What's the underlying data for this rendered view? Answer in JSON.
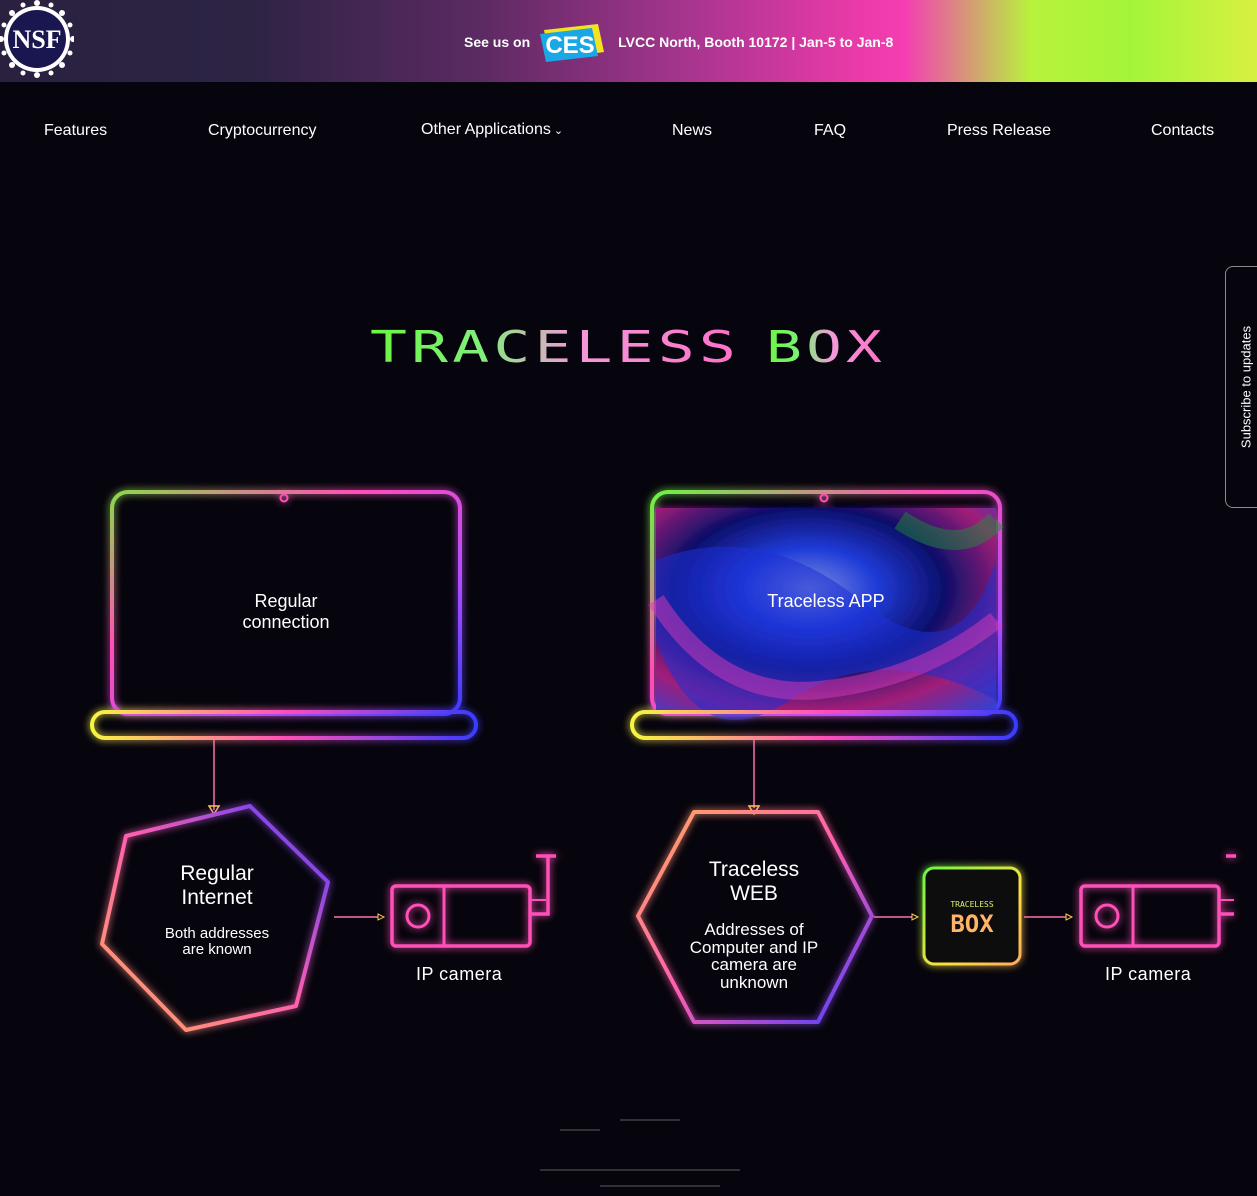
{
  "banner": {
    "nsf_label": "NSF",
    "ces_prefix": "See us on",
    "ces_logo_text": "CES",
    "ces_details": "LVCC North, Booth 10172 | Jan-5 to Jan-8"
  },
  "nav": {
    "items": [
      {
        "label": "Features"
      },
      {
        "label": "Cryptocurrency"
      },
      {
        "label": "Other Applications"
      },
      {
        "label": "News"
      },
      {
        "label": "FAQ"
      },
      {
        "label": "Press Release"
      },
      {
        "label": "Contacts"
      }
    ]
  },
  "hero": {
    "title_left": "TRACELESS",
    "title_right": "BOX"
  },
  "subscribe": {
    "label": "Subscribe to updates"
  },
  "diagram": {
    "left": {
      "laptop_text": "Regular connection",
      "laptop_line1": "Regular",
      "laptop_line2": "connection",
      "hex_title1": "Regular",
      "hex_title2": "Internet",
      "hex_sub1": "Both addresses",
      "hex_sub2": "are known",
      "camera_label": "IP camera"
    },
    "right": {
      "laptop_text": "Traceless APP",
      "hex_title1": "Traceless",
      "hex_title2": "WEB",
      "hex_sub1": "Addresses of",
      "hex_sub2": "Computer and IP",
      "hex_sub3": "camera are",
      "hex_sub4": "unknown",
      "box_top": "TRACELESS",
      "box_bottom": "BOX",
      "camera_label": "IP camera"
    }
  },
  "colors": {
    "neon_green": "#6cf542",
    "neon_pink": "#ff4fb8",
    "neon_blue": "#3b3bff",
    "neon_yellow": "#f7f541",
    "neon_orange": "#ffaa5c"
  }
}
